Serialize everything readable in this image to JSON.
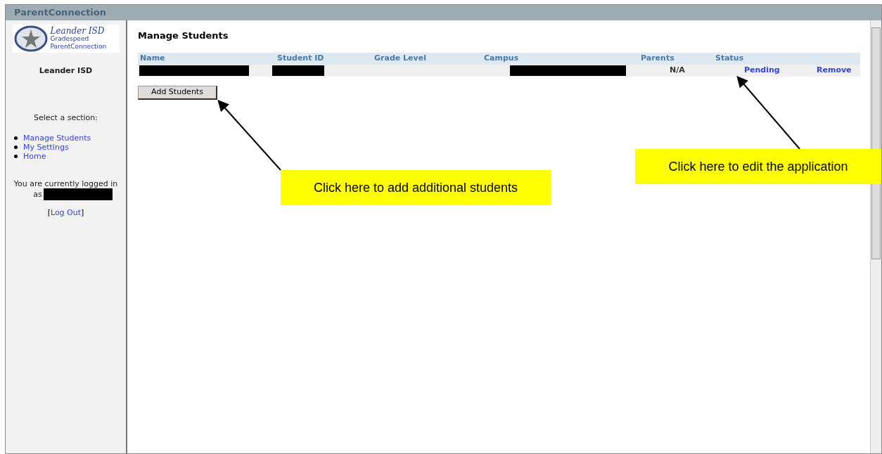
{
  "window": {
    "title": "ParentConnection"
  },
  "sidebar": {
    "logo": {
      "line_1": "Leander ISD",
      "line_2": "Gradespeed",
      "line_3": "ParentConnection"
    },
    "district": "Leander ISD",
    "section_prompt": "Select a section:",
    "items": [
      {
        "label": "Manage Students"
      },
      {
        "label": "My Settings"
      },
      {
        "label": "Home"
      }
    ],
    "login_text_1": "You are currently logged in",
    "login_text_2": "as",
    "logout": {
      "open": "[",
      "label": "Log Out",
      "close": "]"
    }
  },
  "main": {
    "heading": "Manage Students",
    "table": {
      "columns": [
        "Name",
        "Student ID",
        "Grade Level",
        "Campus",
        "Parents",
        "Status"
      ],
      "rows": [
        {
          "parents": "N/A",
          "status": "Pending",
          "action": "Remove"
        }
      ]
    },
    "add_button": "Add Students"
  },
  "callouts": [
    {
      "text": "Click here to add additional students"
    },
    {
      "text": "Click here to edit the application"
    }
  ]
}
